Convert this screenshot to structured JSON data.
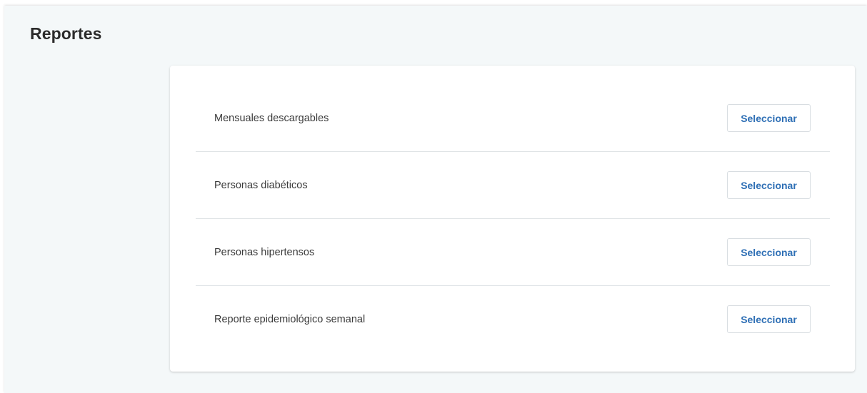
{
  "page": {
    "title": "Reportes"
  },
  "reports": [
    {
      "label": "Mensuales descargables",
      "button_label": "Seleccionar"
    },
    {
      "label": "Personas diabéticos",
      "button_label": "Seleccionar"
    },
    {
      "label": "Personas hipertensos",
      "button_label": "Seleccionar"
    },
    {
      "label": "Reporte epidemiológico semanal",
      "button_label": "Seleccionar"
    }
  ],
  "colors": {
    "background": "#f4f8f9",
    "card": "#ffffff",
    "button_text": "#2e6fb5",
    "divider": "#dfe3e6"
  }
}
